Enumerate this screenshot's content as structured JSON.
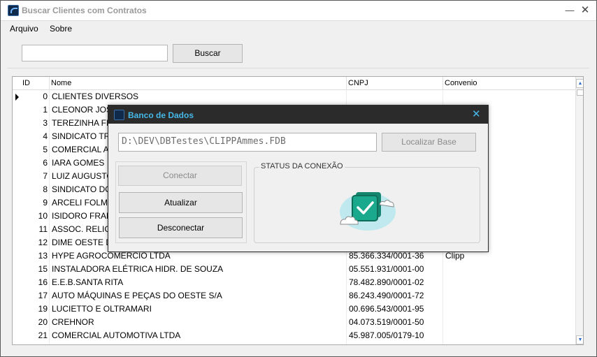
{
  "window": {
    "title": "Buscar Clientes com Contratos",
    "minimize_glyph": "—",
    "close_glyph": "✕"
  },
  "menu": {
    "items": [
      "Arquivo",
      "Sobre"
    ]
  },
  "search": {
    "value": "",
    "button_label": "Buscar"
  },
  "grid": {
    "headers": {
      "id": "ID",
      "nome": "Nome",
      "cnpj": "CNPJ",
      "convenio": "Convenio"
    },
    "rows": [
      {
        "id": "0",
        "nome": "CLIENTES DIVERSOS",
        "cnpj": "",
        "convenio": ""
      },
      {
        "id": "1",
        "nome": "CLEONOR JOSÉ",
        "cnpj": "",
        "convenio": ""
      },
      {
        "id": "3",
        "nome": "TEREZINHA FI",
        "cnpj": "",
        "convenio": ""
      },
      {
        "id": "4",
        "nome": "SINDICATO TR",
        "cnpj": "",
        "convenio": ""
      },
      {
        "id": "5",
        "nome": "COMERCIAL AC",
        "cnpj": "",
        "convenio": ""
      },
      {
        "id": "6",
        "nome": "IARA GOMES",
        "cnpj": "",
        "convenio": ""
      },
      {
        "id": "7",
        "nome": "LUIZ AUGUSTO",
        "cnpj": "",
        "convenio": ""
      },
      {
        "id": "8",
        "nome": "SINDICATO DO",
        "cnpj": "",
        "convenio": ""
      },
      {
        "id": "9",
        "nome": "ARCELI FOLME",
        "cnpj": "",
        "convenio": ""
      },
      {
        "id": "10",
        "nome": "ISIDORO FRAN",
        "cnpj": "",
        "convenio": ""
      },
      {
        "id": "11",
        "nome": "ASSOC. RELIG.",
        "cnpj": "",
        "convenio": ""
      },
      {
        "id": "12",
        "nome": "DIME OESTE D",
        "cnpj": "",
        "convenio": ""
      },
      {
        "id": "13",
        "nome": "HYPE AGROCOMERCIO LTDA",
        "cnpj": "85.366.334/0001-36",
        "convenio": "Clipp"
      },
      {
        "id": "15",
        "nome": "INSTALADORA ELÉTRICA HIDR. DE SOUZA",
        "cnpj": "05.551.931/0001-00",
        "convenio": ""
      },
      {
        "id": "16",
        "nome": "E.E.B.SANTA RITA",
        "cnpj": "78.482.890/0001-02",
        "convenio": ""
      },
      {
        "id": "17",
        "nome": "AUTO MÁQUINAS E PEÇAS DO OESTE S/A",
        "cnpj": "86.243.490/0001-72",
        "convenio": ""
      },
      {
        "id": "19",
        "nome": "LUCIETTO E OLTRAMARI",
        "cnpj": "00.696.543/0001-95",
        "convenio": ""
      },
      {
        "id": "20",
        "nome": "CREHNOR",
        "cnpj": "04.073.519/0001-50",
        "convenio": ""
      },
      {
        "id": "21",
        "nome": "COMERCIAL AUTOMOTIVA LTDA",
        "cnpj": "45.987.005/0179-10",
        "convenio": ""
      }
    ]
  },
  "dialog": {
    "title": "Banco de Dados",
    "close_glyph": "✕",
    "db_path": "D:\\DEV\\DBTestes\\CLIPPAmmes.FDB",
    "locate_button": "Localizar Base",
    "connect_button": "Conectar",
    "refresh_button": "Atualizar",
    "disconnect_button": "Desconectar",
    "status_label": "STATUS DA CONEXÃO",
    "status_icon": "cloud-check-icon"
  },
  "colors": {
    "dialog_title_bg": "#2b2b2b",
    "dialog_title_fg": "#45b8e8",
    "status_teal": "#1aa98c",
    "status_bg": "#bfe9ee"
  }
}
